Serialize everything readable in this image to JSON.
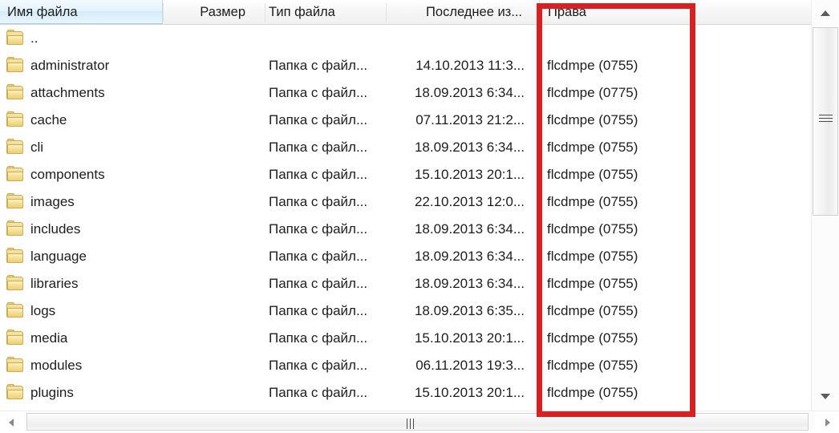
{
  "window": {
    "kind": "file-listing-pane",
    "annotation_color": "#d81f22"
  },
  "columns": [
    {
      "key": "name",
      "label": "Имя файла",
      "sorted": true
    },
    {
      "key": "size",
      "label": "Размер",
      "sorted": false
    },
    {
      "key": "type",
      "label": "Тип файла",
      "sorted": false
    },
    {
      "key": "modified",
      "label": "Последнее из...",
      "sorted": false
    },
    {
      "key": "permissions",
      "label": "Права",
      "sorted": false,
      "highlighted": true
    }
  ],
  "rows": [
    {
      "name": "..",
      "size": "",
      "type": "",
      "modified": "",
      "permissions": ""
    },
    {
      "name": "administrator",
      "size": "",
      "type": "Папка с файл...",
      "modified": "14.10.2013 11:3...",
      "permissions": "flcdmpe (0755)"
    },
    {
      "name": "attachments",
      "size": "",
      "type": "Папка с файл...",
      "modified": "18.09.2013 6:34...",
      "permissions": "flcdmpe (0775)"
    },
    {
      "name": "cache",
      "size": "",
      "type": "Папка с файл...",
      "modified": "07.11.2013 21:2...",
      "permissions": "flcdmpe (0755)"
    },
    {
      "name": "cli",
      "size": "",
      "type": "Папка с файл...",
      "modified": "18.09.2013 6:34...",
      "permissions": "flcdmpe (0755)"
    },
    {
      "name": "components",
      "size": "",
      "type": "Папка с файл...",
      "modified": "15.10.2013 20:1...",
      "permissions": "flcdmpe (0755)"
    },
    {
      "name": "images",
      "size": "",
      "type": "Папка с файл...",
      "modified": "22.10.2013 12:0...",
      "permissions": "flcdmpe (0755)"
    },
    {
      "name": "includes",
      "size": "",
      "type": "Папка с файл...",
      "modified": "18.09.2013 6:34...",
      "permissions": "flcdmpe (0755)"
    },
    {
      "name": "language",
      "size": "",
      "type": "Папка с файл...",
      "modified": "18.09.2013 6:34...",
      "permissions": "flcdmpe (0755)"
    },
    {
      "name": "libraries",
      "size": "",
      "type": "Папка с файл...",
      "modified": "18.09.2013 6:34...",
      "permissions": "flcdmpe (0755)"
    },
    {
      "name": "logs",
      "size": "",
      "type": "Папка с файл...",
      "modified": "18.09.2013 6:35...",
      "permissions": "flcdmpe (0755)"
    },
    {
      "name": "media",
      "size": "",
      "type": "Папка с файл...",
      "modified": "15.10.2013 20:1...",
      "permissions": "flcdmpe (0755)"
    },
    {
      "name": "modules",
      "size": "",
      "type": "Папка с файл...",
      "modified": "06.11.2013 19:3...",
      "permissions": "flcdmpe (0755)"
    },
    {
      "name": "plugins",
      "size": "",
      "type": "Папка с файл...",
      "modified": "15.10.2013 20:1...",
      "permissions": "flcdmpe (0755)"
    }
  ],
  "scrollbars": {
    "vertical": {
      "up_icon": "triangle-up-icon",
      "down_icon": "triangle-down-icon",
      "grip_icon": "grip-horizontal-icon"
    },
    "horizontal": {
      "left_icon": "triangle-left-icon",
      "right_icon": "triangle-right-icon",
      "grip_icon": "grip-vertical-icon"
    }
  }
}
